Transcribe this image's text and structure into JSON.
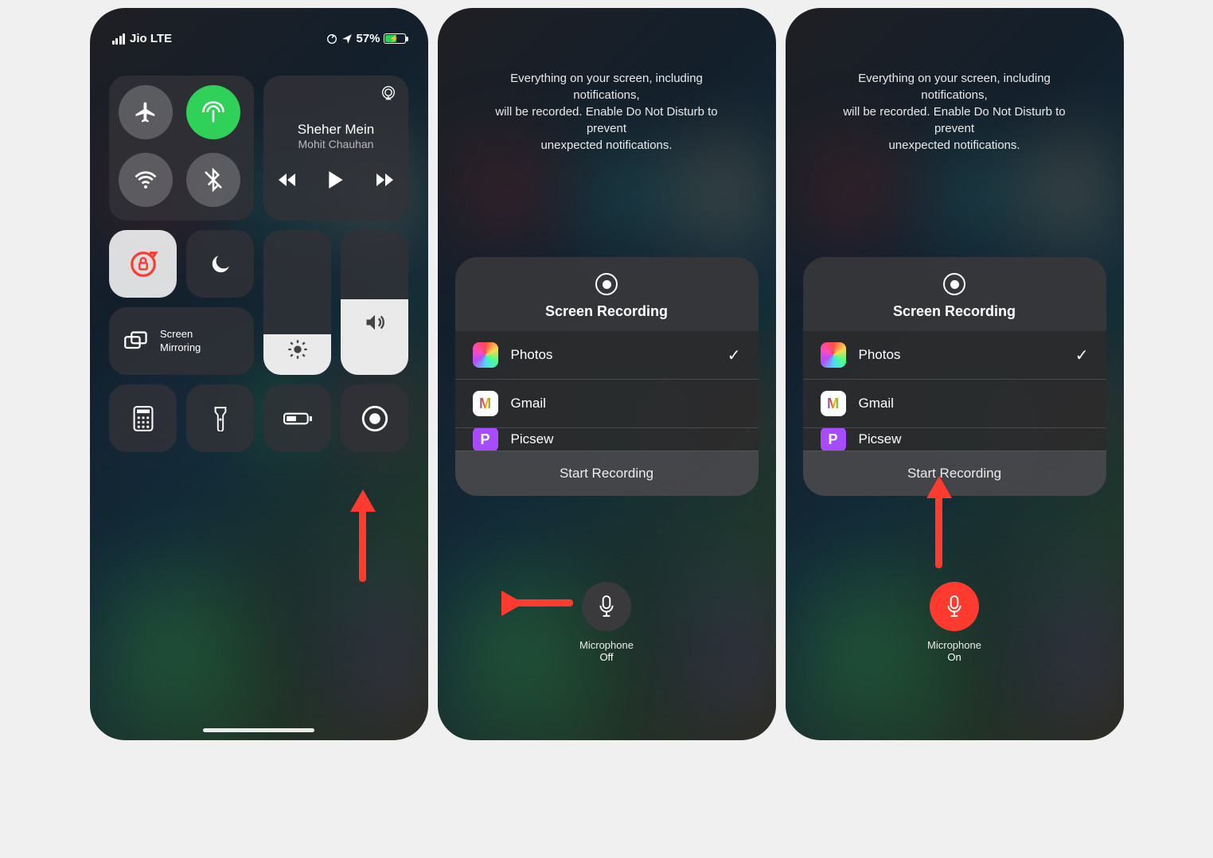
{
  "statusBar": {
    "carrier": "Jio LTE",
    "battery_percent": "57%"
  },
  "music": {
    "title": "Sheher Mein",
    "artist": "Mohit Chauhan"
  },
  "controlCenter": {
    "mirror_label": "Screen\nMirroring"
  },
  "recording": {
    "info_line1": "Everything on your screen, including notifications,",
    "info_line2": "will be recorded. Enable Do Not Disturb to prevent",
    "info_line3": "unexpected notifications.",
    "title": "Screen Recording",
    "options": [
      {
        "name": "Photos",
        "selected": true
      },
      {
        "name": "Gmail",
        "selected": false
      }
    ],
    "partial_option": "Picsew",
    "start_label": "Start Recording",
    "mic_label": "Microphone",
    "mic_off": "Off",
    "mic_on": "On"
  }
}
